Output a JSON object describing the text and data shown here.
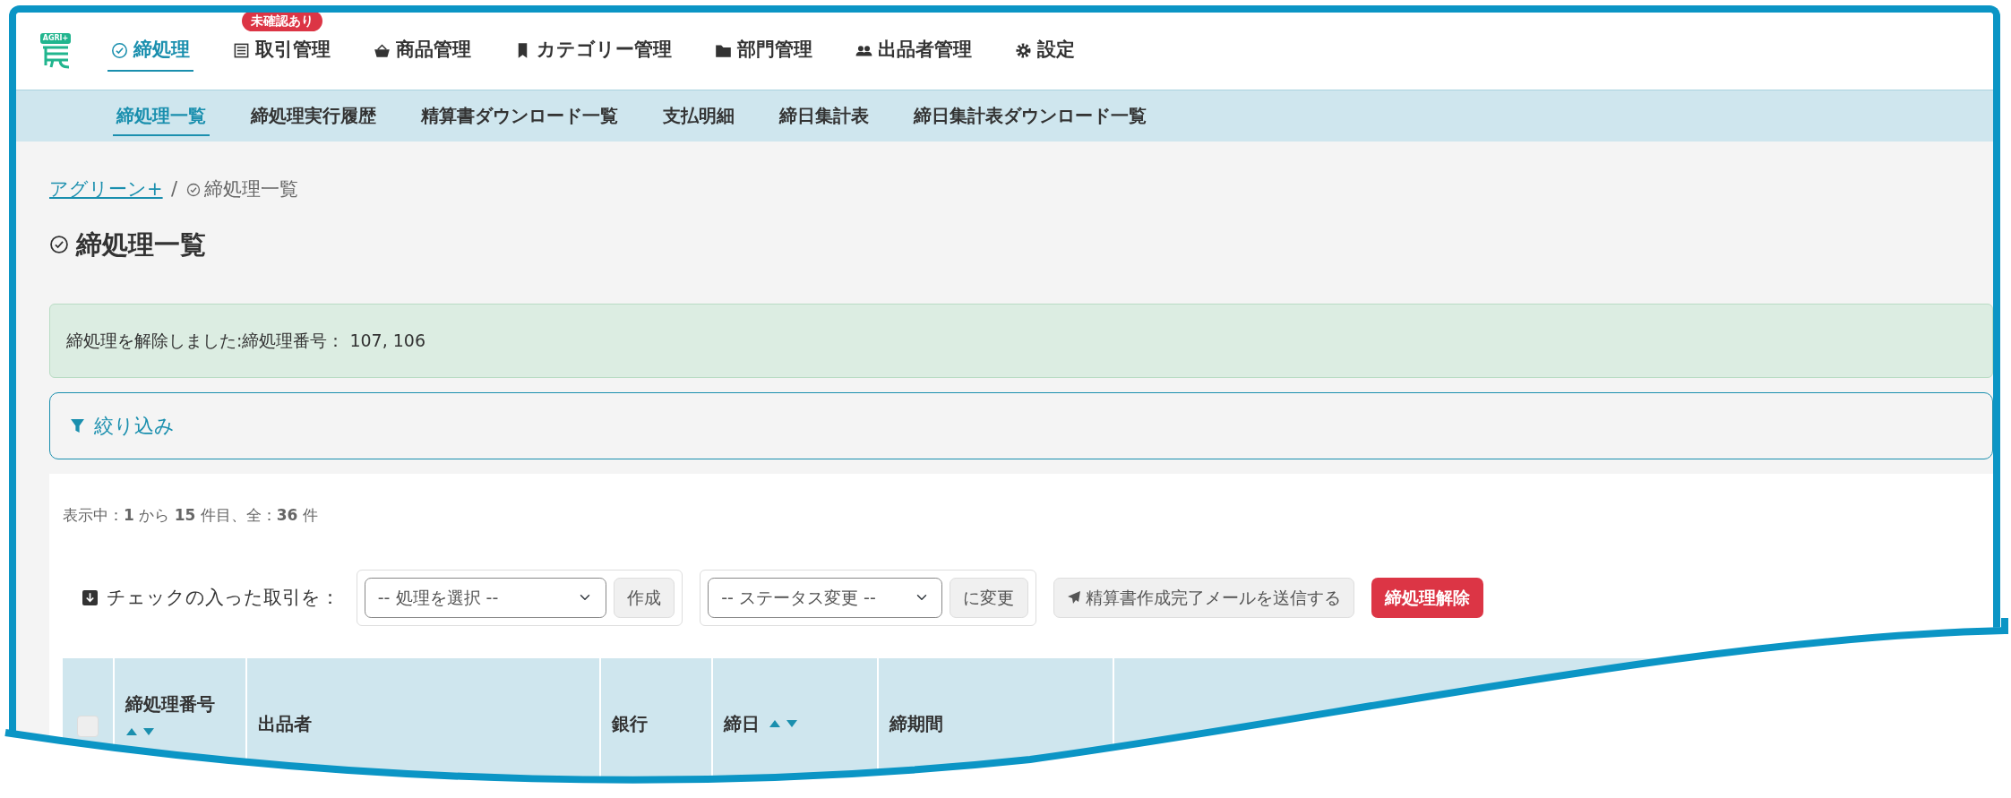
{
  "logo": {
    "label": "AGRI+"
  },
  "main_nav": [
    {
      "label": "締処理",
      "selected": true
    },
    {
      "label": "取引管理",
      "selected": false,
      "badge": "未確認あり"
    },
    {
      "label": "商品管理",
      "selected": false
    },
    {
      "label": "カテゴリー管理",
      "selected": false
    },
    {
      "label": "部門管理",
      "selected": false
    },
    {
      "label": "出品者管理",
      "selected": false
    },
    {
      "label": "設定",
      "selected": false
    }
  ],
  "sub_nav": [
    {
      "label": "締処理一覧",
      "selected": true
    },
    {
      "label": "締処理実行履歴",
      "selected": false
    },
    {
      "label": "精算書ダウンロード一覧",
      "selected": false
    },
    {
      "label": "支払明細",
      "selected": false
    },
    {
      "label": "締日集計表",
      "selected": false
    },
    {
      "label": "締日集計表ダウンロード一覧",
      "selected": false
    }
  ],
  "breadcrumb": [
    {
      "label": "アグリーン+"
    },
    {
      "label": "締処理一覧"
    }
  ],
  "breadcrumb_separator": "/",
  "page_title": "締処理一覧",
  "alert": "締処理を解除しました:締処理番号： 107, 106",
  "filter": {
    "label": "絞り込み"
  },
  "count_text": "表示中：**1** から **15** 件目、全：**36** 件",
  "bulk_actions": {
    "label": "チェックの入った取引を：",
    "groups": [
      {
        "placeholder": "-- 処理を選択 --",
        "button": "作成"
      },
      {
        "placeholder": "-- ステータス変更 --",
        "button": "に変更"
      }
    ],
    "mail_button": "精算書作成完了メールを送信する",
    "release_button": "締処理解除"
  },
  "table": {
    "select_all_checked": false,
    "columns": [
      {
        "label": "締処理番号",
        "sortable": true
      },
      {
        "label": "出品者",
        "sortable": false
      },
      {
        "label": "銀行",
        "sortable": false
      },
      {
        "label": "締日",
        "sortable": true
      },
      {
        "label": "締期間",
        "sortable": false
      }
    ]
  }
}
